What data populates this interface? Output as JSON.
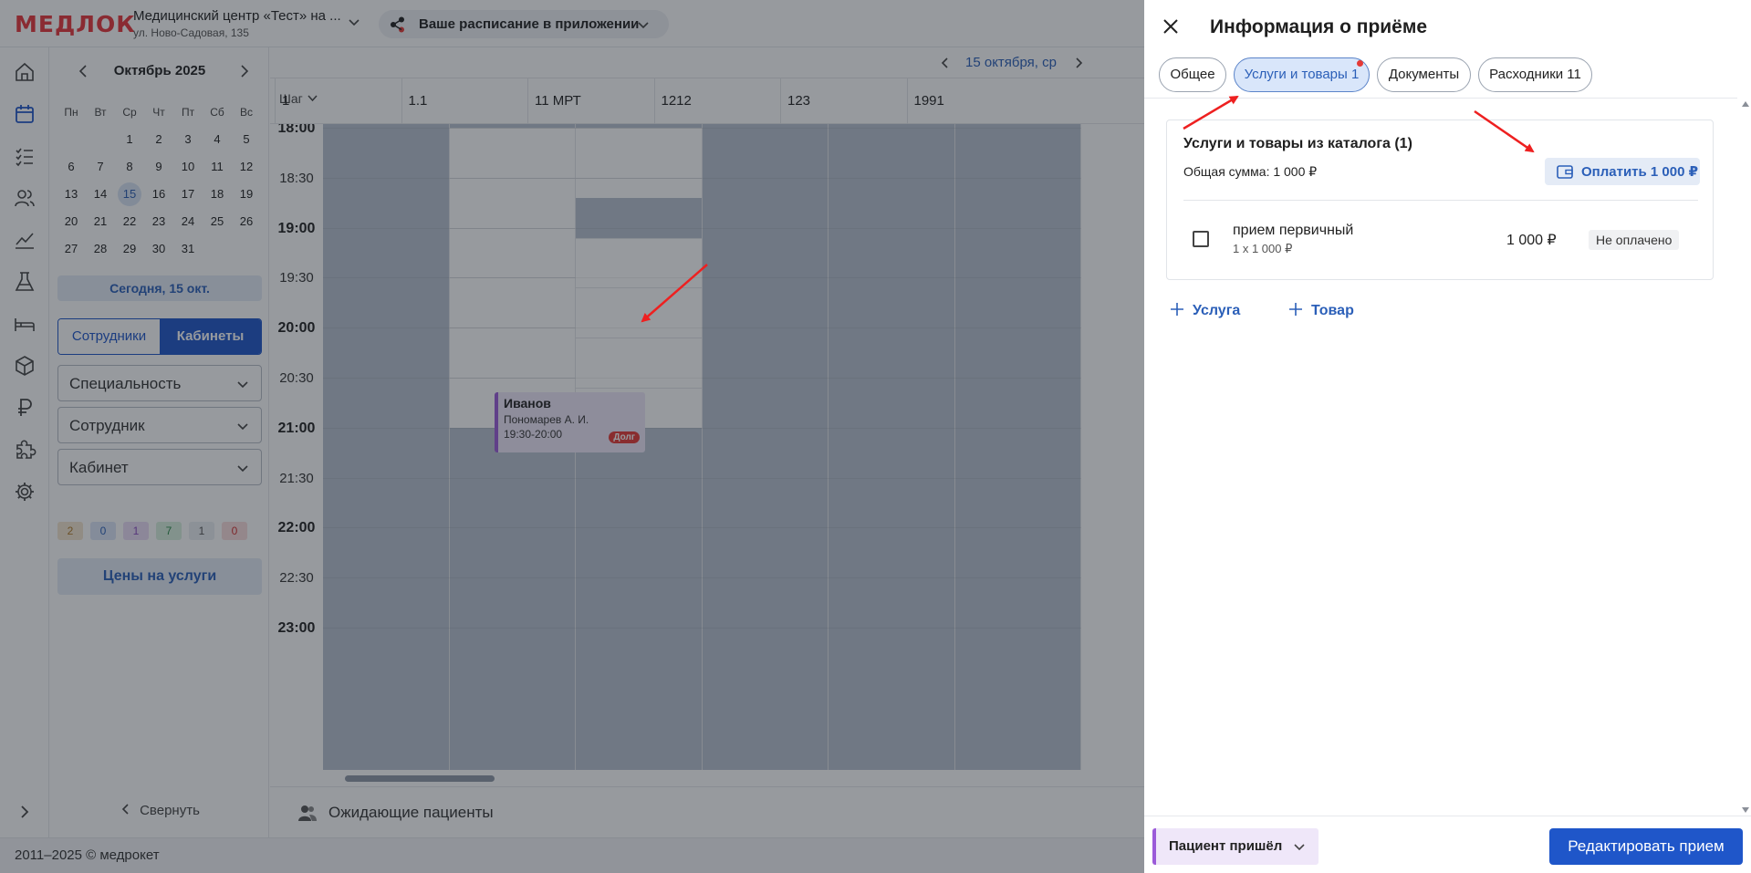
{
  "header": {
    "logo": "МЕДЛОК",
    "clinic_name": "Медицинский центр «Тест» на ...",
    "clinic_address": "ул. Ново-Садовая, 135",
    "app_promo": "Ваше расписание в приложении"
  },
  "calendar": {
    "month": "Октябрь 2025",
    "weekdays": [
      "Пн",
      "Вт",
      "Ср",
      "Чт",
      "Пт",
      "Сб",
      "Вс"
    ],
    "weeks": [
      [
        "",
        "",
        "1",
        "2",
        "3",
        "4",
        "5"
      ],
      [
        "6",
        "7",
        "8",
        "9",
        "10",
        "11",
        "12"
      ],
      [
        "13",
        "14",
        "15",
        "16",
        "17",
        "18",
        "19"
      ],
      [
        "20",
        "21",
        "22",
        "23",
        "24",
        "25",
        "26"
      ],
      [
        "27",
        "28",
        "29",
        "30",
        "31",
        "",
        ""
      ]
    ],
    "selected_day": "15",
    "today_button": "Сегодня, 15 окт."
  },
  "filters": {
    "seg_staff": "Сотрудники",
    "seg_rooms": "Кабинеты",
    "specialty": "Специальность",
    "employee": "Сотрудник",
    "room": "Кабинет",
    "counters": [
      {
        "value": "2",
        "bg": "#f5e6cf",
        "fg": "#b07a2a"
      },
      {
        "value": "0",
        "bg": "#dce6f7",
        "fg": "#2b5fb8"
      },
      {
        "value": "1",
        "bg": "#ecdcf6",
        "fg": "#8a4cc0"
      },
      {
        "value": "7",
        "bg": "#d9f0df",
        "fg": "#2d8a49"
      },
      {
        "value": "1",
        "bg": "#eceef2",
        "fg": "#555555"
      },
      {
        "value": "0",
        "bg": "#fadcdc",
        "fg": "#d23232"
      }
    ],
    "prices_button": "Цены на услуги",
    "collapse": "Свернуть"
  },
  "schedule": {
    "date": "15 октября, ср",
    "step_label": "Шаг",
    "columns": [
      "1",
      "1.1",
      "11 МРТ",
      "1212",
      "123",
      "1991"
    ],
    "times": [
      "18:00",
      "18:30",
      "19:00",
      "19:30",
      "20:00",
      "20:30",
      "21:00",
      "21:30",
      "22:00",
      "22:30",
      "23:00"
    ],
    "appointment": {
      "patient": "Иванов",
      "doctor": "Пономарев А. И.",
      "time": "19:30-20:00",
      "badge": "Долг"
    },
    "waiting_label": "Ожидающие пациенты"
  },
  "footer": {
    "copyright": "2011–2025 © медрокет"
  },
  "drawer": {
    "title": "Информация о приёме",
    "tabs": [
      "Общее",
      "Услуги и товары 1",
      "Документы",
      "Расходники 11"
    ],
    "active_tab": 1,
    "catalog": {
      "heading": "Услуги и товары из каталога (1)",
      "total": "Общая сумма: 1 000 ₽",
      "pay_button": "Оплатить 1 000 ₽",
      "item": {
        "name": "прием первичный",
        "qty": "1 х 1 000 ₽",
        "price": "1 000 ₽",
        "status": "Не оплачено"
      }
    },
    "add_service": "Услуга",
    "add_product": "Товар",
    "patient_status": "Пациент пришёл",
    "edit_button": "Редактировать прием"
  },
  "colors": {
    "accent": "#1f56c9",
    "link": "#2b5fb8",
    "appointment": "#9b5bd9",
    "debt": "#e53935",
    "annotation_arrow": "#ee2020"
  }
}
